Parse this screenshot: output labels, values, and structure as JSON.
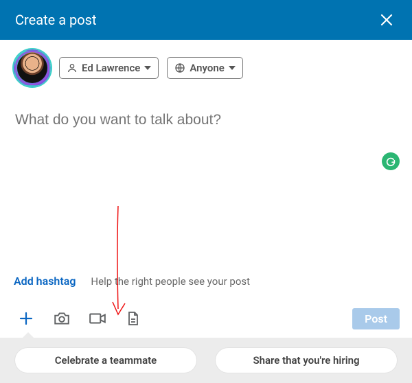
{
  "header": {
    "title": "Create a post"
  },
  "author": {
    "name": "Ed Lawrence"
  },
  "visibility": {
    "label": "Anyone"
  },
  "compose": {
    "placeholder": "What do you want to talk about?"
  },
  "hashtag": {
    "add_label": "Add hashtag",
    "help_text": "Help the right people see your post"
  },
  "actions": {
    "post_label": "Post"
  },
  "suggestions": {
    "items": [
      {
        "label": "Celebrate a teammate"
      },
      {
        "label": "Share that you're hiring"
      }
    ]
  }
}
